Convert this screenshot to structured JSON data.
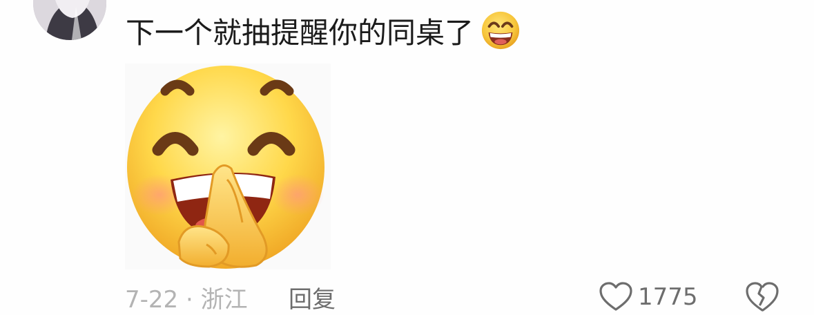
{
  "comment": {
    "text": "下一个就抽提醒你的同桌了",
    "inline_emoji": "grinning-face-emoji",
    "sticker": "smiling-face-rubbing-hands-sticker"
  },
  "footer": {
    "date_location": "7-22 · 浙江",
    "reply_label": "回复",
    "like_count": "1775",
    "like_icon": "heart-outline-icon",
    "dislike_icon": "broken-heart-icon"
  },
  "colors": {
    "text": "#1b1b1b",
    "meta": "#b3b3b3",
    "action": "#6d6d6d",
    "emoji_yellow": "#f7c63b"
  }
}
